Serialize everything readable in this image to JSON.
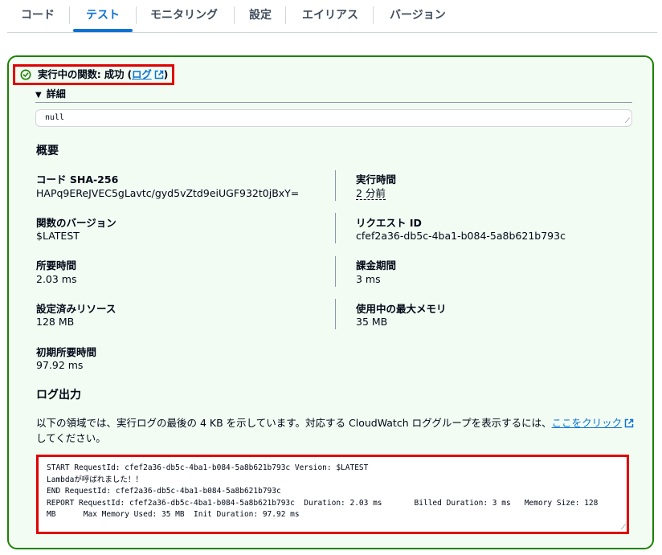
{
  "tabs": [
    {
      "label": "コード"
    },
    {
      "label": "テスト"
    },
    {
      "label": "モニタリング"
    },
    {
      "label": "設定"
    },
    {
      "label": "エイリアス"
    },
    {
      "label": "バージョン"
    }
  ],
  "active_tab": "テスト",
  "result": {
    "status_prefix": "実行中の関数: 成功 (",
    "log_link": "ログ",
    "status_suffix": ")",
    "details_label": "詳細",
    "output_value": "null"
  },
  "summary": {
    "title": "概要",
    "code_sha_label": "コード SHA-256",
    "code_sha_value": "HAPq9EReJVEC5gLavtc/gyd5vZtd9eiUGF932t0jBxY=",
    "exec_time_label": "実行時間",
    "exec_time_value": "2 分前",
    "function_version_label": "関数のバージョン",
    "function_version_value": "$LATEST",
    "request_id_label": "リクエスト ID",
    "request_id_value": "cfef2a36-db5c-4ba1-b084-5a8b621b793c",
    "duration_label": "所要時間",
    "duration_value": "2.03 ms",
    "billed_duration_label": "課金期間",
    "billed_duration_value": "3 ms",
    "resources_label": "設定済みリソース",
    "resources_value": "128 MB",
    "max_memory_label": "使用中の最大メモリ",
    "max_memory_value": "35 MB",
    "init_duration_label": "初期所要時間",
    "init_duration_value": "97.92 ms"
  },
  "log_output": {
    "title": "ログ出力",
    "description_prefix": "以下の領域では、実行ログの最後の 4 KB を示しています。対応する CloudWatch ロググループを表示するには、",
    "link_text": "ここをクリック",
    "description_suffix": "してください。",
    "log_text": "START RequestId: cfef2a36-db5c-4ba1-b084-5a8b621b793c Version: $LATEST\nLambdaが呼ばれました！！\nEND RequestId: cfef2a36-db5c-4ba1-b084-5a8b621b793c\nREPORT RequestId: cfef2a36-db5c-4ba1-b084-5a8b621b793c  Duration: 2.03 ms       Billed Duration: 3 ms   Memory Size: 128\nMB      Max Memory Used: 35 MB  Init Duration: 97.92 ms"
  },
  "icons": {
    "status": "check-circle-icon",
    "external": "external-link-icon",
    "expand": "caret-down-icon",
    "resize": "resize-handle-icon"
  },
  "colors": {
    "accent": "#0972d3",
    "success_border": "#1d8102",
    "success_background": "#f2fcf3",
    "highlight": "#e00000"
  }
}
